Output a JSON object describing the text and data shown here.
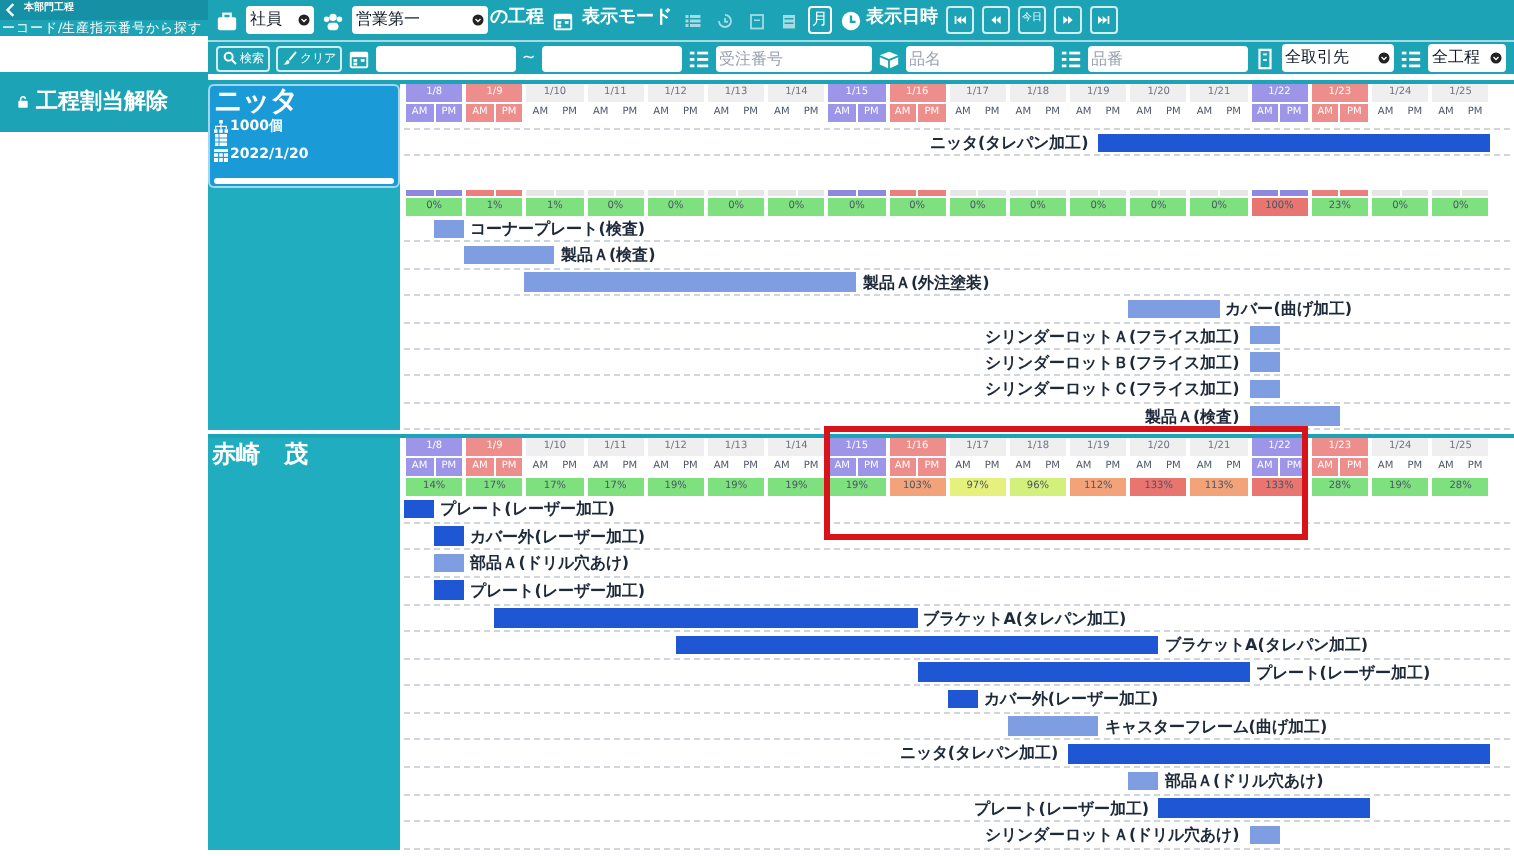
{
  "sidebar": {
    "title": "本部門工程",
    "hint": "ーコード/生産指示番号から探す",
    "action": "工程割当解除"
  },
  "toolbar": {
    "employee_select": "社員",
    "department_select": "営業第一",
    "suffix": "の工程",
    "display_mode_label": "表示モード",
    "view_modes": [
      {
        "kind": "list",
        "selected": false
      },
      {
        "kind": "history",
        "selected": false
      },
      {
        "kind": "day",
        "selected": false
      },
      {
        "kind": "week",
        "selected": false
      },
      {
        "label": "月",
        "selected": true
      }
    ],
    "datetime_label": "表示日時",
    "nav": [
      {
        "kind": "first"
      },
      {
        "kind": "prev"
      },
      {
        "kind": "today",
        "label": "今日"
      },
      {
        "kind": "next"
      },
      {
        "kind": "last"
      }
    ]
  },
  "filters": {
    "search_button": "検索",
    "clear_button": "クリア",
    "range_separator": "~",
    "order_number": {
      "placeholder": "受注番号"
    },
    "item_name": {
      "placeholder": "品名"
    },
    "item_number": {
      "placeholder": "品番"
    },
    "client_select": "全取引先",
    "process_select": "全工程"
  },
  "groups": [
    {
      "kind": "product",
      "name": "ニッタ",
      "quantity": "1000個",
      "due_date": "2022/1/20",
      "days": [
        {
          "date": "1/8",
          "kind": "saturday",
          "am": "AM",
          "pm": "PM"
        },
        {
          "date": "1/9",
          "kind": "sunday",
          "am": "AM",
          "pm": "PM"
        },
        {
          "date": "1/10",
          "kind": "weekday",
          "am": "AM",
          "pm": "PM"
        },
        {
          "date": "1/11",
          "kind": "weekday",
          "am": "AM",
          "pm": "PM"
        },
        {
          "date": "1/12",
          "kind": "weekday",
          "am": "AM",
          "pm": "PM"
        },
        {
          "date": "1/13",
          "kind": "weekday",
          "am": "AM",
          "pm": "PM"
        },
        {
          "date": "1/14",
          "kind": "weekday",
          "am": "AM",
          "pm": "PM"
        },
        {
          "date": "1/15",
          "kind": "saturday",
          "am": "AM",
          "pm": "PM"
        },
        {
          "date": "1/16",
          "kind": "sunday",
          "am": "AM",
          "pm": "PM"
        },
        {
          "date": "1/17",
          "kind": "weekday",
          "am": "AM",
          "pm": "PM"
        },
        {
          "date": "1/18",
          "kind": "weekday",
          "am": "AM",
          "pm": "PM"
        },
        {
          "date": "1/19",
          "kind": "weekday",
          "am": "AM",
          "pm": "PM"
        },
        {
          "date": "1/20",
          "kind": "weekday",
          "am": "AM",
          "pm": "PM"
        },
        {
          "date": "1/21",
          "kind": "weekday",
          "am": "AM",
          "pm": "PM"
        },
        {
          "date": "1/22",
          "kind": "saturday",
          "am": "AM",
          "pm": "PM"
        },
        {
          "date": "1/23",
          "kind": "sunday",
          "am": "AM",
          "pm": "PM"
        },
        {
          "date": "1/24",
          "kind": "weekday",
          "am": "AM",
          "pm": "PM"
        },
        {
          "date": "1/25",
          "kind": "weekday",
          "am": "AM",
          "pm": "PM"
        }
      ],
      "summary_bar": {
        "label": "ニッタ(タレパン加工)",
        "color": "#1f56d4",
        "label_left": true,
        "schedule": [
          false,
          false,
          false,
          false,
          false,
          false,
          false,
          false,
          false,
          false,
          false,
          false,
          false,
          false,
          false,
          false,
          false,
          false,
          false,
          false,
          false,
          false,
          false,
          true,
          true,
          true,
          true,
          true,
          true,
          true,
          true,
          true,
          true,
          true,
          true,
          true
        ]
      },
      "loads": [
        {
          "text": "0%",
          "color": "#7fe07f"
        },
        {
          "text": "1%",
          "color": "#7fe07f"
        },
        {
          "text": "1%",
          "color": "#7fe07f"
        },
        {
          "text": "0%",
          "color": "#7fe07f"
        },
        {
          "text": "0%",
          "color": "#7fe07f"
        },
        {
          "text": "0%",
          "color": "#7fe07f"
        },
        {
          "text": "0%",
          "color": "#7fe07f"
        },
        {
          "text": "0%",
          "color": "#7fe07f"
        },
        {
          "text": "0%",
          "color": "#7fe07f"
        },
        {
          "text": "0%",
          "color": "#7fe07f"
        },
        {
          "text": "0%",
          "color": "#7fe07f"
        },
        {
          "text": "0%",
          "color": "#7fe07f"
        },
        {
          "text": "0%",
          "color": "#7fe07f"
        },
        {
          "text": "0%",
          "color": "#7fe07f"
        },
        {
          "text": "100%",
          "color": "#e8756f"
        },
        {
          "text": "23%",
          "color": "#7fe07f"
        },
        {
          "text": "0%",
          "color": "#7fe07f"
        },
        {
          "text": "0%",
          "color": "#7fe07f"
        }
      ],
      "tasks": [
        {
          "label": "コーナープレート(検査)",
          "color": "#7f9ee2",
          "label_left": false,
          "schedule": [
            false,
            true,
            false,
            false,
            false,
            false,
            false,
            false,
            false,
            false,
            false,
            false,
            false,
            false,
            false,
            false,
            false,
            false,
            false,
            false,
            false,
            false,
            false,
            false,
            false,
            false,
            false,
            false,
            false,
            false,
            false,
            false,
            false,
            false,
            false,
            false
          ]
        },
        {
          "label": "製品Ａ(検査)",
          "color": "#7f9ee2",
          "label_left": false,
          "schedule": [
            false,
            false,
            true,
            true,
            true,
            false,
            false,
            false,
            false,
            false,
            false,
            false,
            false,
            false,
            false,
            false,
            false,
            false,
            false,
            false,
            false,
            false,
            false,
            false,
            false,
            false,
            false,
            false,
            false,
            false,
            false,
            false,
            false,
            false,
            false,
            false
          ]
        },
        {
          "label": "製品Ａ(外注塗装)",
          "color": "#7f9ee2",
          "label_left": false,
          "schedule": [
            false,
            false,
            false,
            false,
            true,
            true,
            true,
            true,
            true,
            true,
            true,
            true,
            true,
            true,
            true,
            false,
            false,
            false,
            false,
            false,
            false,
            false,
            false,
            false,
            false,
            false,
            false,
            false,
            false,
            false,
            false,
            false,
            false,
            false,
            false,
            false
          ]
        },
        {
          "label": "カバー(曲げ加工)",
          "color": "#7f9ee2",
          "label_left": false,
          "schedule": [
            false,
            false,
            false,
            false,
            false,
            false,
            false,
            false,
            false,
            false,
            false,
            false,
            false,
            false,
            false,
            false,
            false,
            false,
            false,
            false,
            false,
            false,
            false,
            false,
            true,
            true,
            true,
            false,
            false,
            false,
            false,
            false,
            false,
            false,
            false,
            false
          ]
        },
        {
          "label": "シリンダーロットＡ(フライス加工)",
          "color": "#7f9ee2",
          "label_left": true,
          "schedule": [
            false,
            false,
            false,
            false,
            false,
            false,
            false,
            false,
            false,
            false,
            false,
            false,
            false,
            false,
            false,
            false,
            false,
            false,
            false,
            false,
            false,
            false,
            false,
            false,
            false,
            false,
            false,
            false,
            true,
            false,
            false,
            false,
            false,
            false,
            false,
            false
          ]
        },
        {
          "label": "シリンダーロットＢ(フライス加工)",
          "color": "#7f9ee2",
          "label_left": true,
          "schedule": [
            false,
            false,
            false,
            false,
            false,
            false,
            false,
            false,
            false,
            false,
            false,
            false,
            false,
            false,
            false,
            false,
            false,
            false,
            false,
            false,
            false,
            false,
            false,
            false,
            false,
            false,
            false,
            false,
            true,
            false,
            false,
            false,
            false,
            false,
            false,
            false
          ]
        },
        {
          "label": "シリンダーロットＣ(フライス加工)",
          "color": "#7f9ee2",
          "label_left": true,
          "schedule": [
            false,
            false,
            false,
            false,
            false,
            false,
            false,
            false,
            false,
            false,
            false,
            false,
            false,
            false,
            false,
            false,
            false,
            false,
            false,
            false,
            false,
            false,
            false,
            false,
            false,
            false,
            false,
            false,
            true,
            false,
            false,
            false,
            false,
            false,
            false,
            false
          ]
        },
        {
          "label": "製品Ａ(検査)",
          "color": "#7f9ee2",
          "label_left": true,
          "schedule": [
            false,
            false,
            false,
            false,
            false,
            false,
            false,
            false,
            false,
            false,
            false,
            false,
            false,
            false,
            false,
            false,
            false,
            false,
            false,
            false,
            false,
            false,
            false,
            false,
            false,
            false,
            false,
            false,
            true,
            true,
            true,
            false,
            false,
            false,
            false,
            false
          ]
        }
      ]
    },
    {
      "kind": "employee",
      "name": "赤崎　茂",
      "days": [
        {
          "date": "1/8",
          "kind": "saturday",
          "am": "AM",
          "pm": "PM"
        },
        {
          "date": "1/9",
          "kind": "sunday",
          "am": "AM",
          "pm": "PM"
        },
        {
          "date": "1/10",
          "kind": "weekday",
          "am": "AM",
          "pm": "PM"
        },
        {
          "date": "1/11",
          "kind": "weekday",
          "am": "AM",
          "pm": "PM"
        },
        {
          "date": "1/12",
          "kind": "weekday",
          "am": "AM",
          "pm": "PM"
        },
        {
          "date": "1/13",
          "kind": "weekday",
          "am": "AM",
          "pm": "PM"
        },
        {
          "date": "1/14",
          "kind": "weekday",
          "am": "AM",
          "pm": "PM"
        },
        {
          "date": "1/15",
          "kind": "saturday",
          "am": "AM",
          "pm": "PM"
        },
        {
          "date": "1/16",
          "kind": "sunday",
          "am": "AM",
          "pm": "PM"
        },
        {
          "date": "1/17",
          "kind": "weekday",
          "am": "AM",
          "pm": "PM"
        },
        {
          "date": "1/18",
          "kind": "weekday",
          "am": "AM",
          "pm": "PM"
        },
        {
          "date": "1/19",
          "kind": "weekday",
          "am": "AM",
          "pm": "PM"
        },
        {
          "date": "1/20",
          "kind": "weekday",
          "am": "AM",
          "pm": "PM"
        },
        {
          "date": "1/21",
          "kind": "weekday",
          "am": "AM",
          "pm": "PM"
        },
        {
          "date": "1/22",
          "kind": "saturday",
          "am": "AM",
          "pm": "PM"
        },
        {
          "date": "1/23",
          "kind": "sunday",
          "am": "AM",
          "pm": "PM"
        },
        {
          "date": "1/24",
          "kind": "weekday",
          "am": "AM",
          "pm": "PM"
        },
        {
          "date": "1/25",
          "kind": "weekday",
          "am": "AM",
          "pm": "PM"
        }
      ],
      "loads": [
        {
          "text": "14%",
          "color": "#7fe07f",
          "highlighted": false
        },
        {
          "text": "17%",
          "color": "#7fe07f",
          "highlighted": false
        },
        {
          "text": "17%",
          "color": "#7fe07f",
          "highlighted": false
        },
        {
          "text": "17%",
          "color": "#7fe07f",
          "highlighted": false
        },
        {
          "text": "19%",
          "color": "#7fe07f",
          "highlighted": false
        },
        {
          "text": "19%",
          "color": "#7fe07f",
          "highlighted": false
        },
        {
          "text": "19%",
          "color": "#7fe07f",
          "highlighted": false
        },
        {
          "text": "19%",
          "color": "#7fe07f",
          "highlighted": true
        },
        {
          "text": "103%",
          "color": "#f2a37a",
          "highlighted": true
        },
        {
          "text": "97%",
          "color": "#e6f07c",
          "highlighted": true
        },
        {
          "text": "96%",
          "color": "#d3ef7c",
          "highlighted": true
        },
        {
          "text": "112%",
          "color": "#f2a37a",
          "highlighted": true
        },
        {
          "text": "133%",
          "color": "#e8756f",
          "highlighted": true
        },
        {
          "text": "113%",
          "color": "#f2a37a",
          "highlighted": true
        },
        {
          "text": "133%",
          "color": "#e8756f",
          "highlighted": true
        },
        {
          "text": "28%",
          "color": "#7fe07f",
          "highlighted": false
        },
        {
          "text": "19%",
          "color": "#7fe07f",
          "highlighted": false
        },
        {
          "text": "28%",
          "color": "#7fe07f",
          "highlighted": false
        }
      ],
      "tasks": [
        {
          "label": "プレート(レーザー加工)",
          "color": "#1f56d4",
          "label_left": false,
          "schedule": [
            true,
            false,
            false,
            false,
            false,
            false,
            false,
            false,
            false,
            false,
            false,
            false,
            false,
            false,
            false,
            false,
            false,
            false,
            false,
            false,
            false,
            false,
            false,
            false,
            false,
            false,
            false,
            false,
            false,
            false,
            false,
            false,
            false,
            false,
            false,
            false
          ]
        },
        {
          "label": "カバー外(レーザー加工)",
          "color": "#1f56d4",
          "label_left": false,
          "schedule": [
            false,
            true,
            false,
            false,
            false,
            false,
            false,
            false,
            false,
            false,
            false,
            false,
            false,
            false,
            false,
            false,
            false,
            false,
            false,
            false,
            false,
            false,
            false,
            false,
            false,
            false,
            false,
            false,
            false,
            false,
            false,
            false,
            false,
            false,
            false,
            false
          ]
        },
        {
          "label": "部品Ａ(ドリル穴あけ)",
          "color": "#7f9ee2",
          "label_left": false,
          "schedule": [
            false,
            true,
            false,
            false,
            false,
            false,
            false,
            false,
            false,
            false,
            false,
            false,
            false,
            false,
            false,
            false,
            false,
            false,
            false,
            false,
            false,
            false,
            false,
            false,
            false,
            false,
            false,
            false,
            false,
            false,
            false,
            false,
            false,
            false,
            false,
            false
          ]
        },
        {
          "label": "プレート(レーザー加工)",
          "color": "#1f56d4",
          "label_left": false,
          "schedule": [
            false,
            true,
            false,
            false,
            false,
            false,
            false,
            false,
            false,
            false,
            false,
            false,
            false,
            false,
            false,
            false,
            false,
            false,
            false,
            false,
            false,
            false,
            false,
            false,
            false,
            false,
            false,
            false,
            false,
            false,
            false,
            false,
            false,
            false,
            false,
            false
          ]
        },
        {
          "label": "ブラケットA(タレパン加工)",
          "color": "#1f56d4",
          "label_left": false,
          "schedule": [
            false,
            false,
            false,
            true,
            true,
            true,
            true,
            true,
            true,
            true,
            true,
            true,
            true,
            true,
            true,
            true,
            true,
            false,
            false,
            false,
            false,
            false,
            false,
            false,
            false,
            false,
            false,
            false,
            false,
            false,
            false,
            false,
            false,
            false,
            false,
            false
          ]
        },
        {
          "label": "ブラケットA(タレパン加工)",
          "color": "#1f56d4",
          "label_left": false,
          "schedule": [
            false,
            false,
            false,
            false,
            false,
            false,
            false,
            false,
            false,
            true,
            true,
            true,
            true,
            true,
            true,
            true,
            true,
            true,
            true,
            true,
            true,
            true,
            true,
            true,
            true,
            false,
            false,
            false,
            false,
            false,
            false,
            false,
            false,
            false,
            false,
            false
          ]
        },
        {
          "label": "プレート(レーザー加工)",
          "color": "#1f56d4",
          "label_left": false,
          "schedule": [
            false,
            false,
            false,
            false,
            false,
            false,
            false,
            false,
            false,
            false,
            false,
            false,
            false,
            false,
            false,
            false,
            false,
            true,
            true,
            true,
            true,
            true,
            true,
            true,
            true,
            true,
            true,
            true,
            false,
            false,
            false,
            false,
            false,
            false,
            false,
            false
          ]
        },
        {
          "label": "カバー外(レーザー加工)",
          "color": "#1f56d4",
          "label_left": false,
          "schedule": [
            false,
            false,
            false,
            false,
            false,
            false,
            false,
            false,
            false,
            false,
            false,
            false,
            false,
            false,
            false,
            false,
            false,
            false,
            true,
            false,
            false,
            false,
            false,
            false,
            false,
            false,
            false,
            false,
            false,
            false,
            false,
            false,
            false,
            false,
            false,
            false
          ]
        },
        {
          "label": "キャスターフレーム(曲げ加工)",
          "color": "#7f9ee2",
          "label_left": false,
          "schedule": [
            false,
            false,
            false,
            false,
            false,
            false,
            false,
            false,
            false,
            false,
            false,
            false,
            false,
            false,
            false,
            false,
            false,
            false,
            false,
            false,
            true,
            true,
            true,
            false,
            false,
            false,
            false,
            false,
            false,
            false,
            false,
            false,
            false,
            false,
            false,
            false
          ]
        },
        {
          "label": "ニッタ(タレパン加工)",
          "color": "#1f56d4",
          "label_left": true,
          "schedule": [
            false,
            false,
            false,
            false,
            false,
            false,
            false,
            false,
            false,
            false,
            false,
            false,
            false,
            false,
            false,
            false,
            false,
            false,
            false,
            false,
            false,
            false,
            true,
            true,
            true,
            true,
            true,
            true,
            true,
            true,
            true,
            true,
            true,
            true,
            true,
            true
          ]
        },
        {
          "label": "部品Ａ(ドリル穴あけ)",
          "color": "#7f9ee2",
          "label_left": false,
          "schedule": [
            false,
            false,
            false,
            false,
            false,
            false,
            false,
            false,
            false,
            false,
            false,
            false,
            false,
            false,
            false,
            false,
            false,
            false,
            false,
            false,
            false,
            false,
            false,
            false,
            true,
            false,
            false,
            false,
            false,
            false,
            false,
            false,
            false,
            false,
            false,
            false
          ]
        },
        {
          "label": "プレート(レーザー加工)",
          "color": "#1f56d4",
          "label_left": true,
          "schedule": [
            false,
            false,
            false,
            false,
            false,
            false,
            false,
            false,
            false,
            false,
            false,
            false,
            false,
            false,
            false,
            false,
            false,
            false,
            false,
            false,
            false,
            false,
            false,
            false,
            false,
            true,
            true,
            true,
            true,
            true,
            true,
            true,
            false,
            false,
            false,
            false
          ]
        },
        {
          "label": "シリンダーロットＡ(ドリル穴あけ)",
          "color": "#7f9ee2",
          "label_left": true,
          "schedule": [
            false,
            false,
            false,
            false,
            false,
            false,
            false,
            false,
            false,
            false,
            false,
            false,
            false,
            false,
            false,
            false,
            false,
            false,
            false,
            false,
            false,
            false,
            false,
            false,
            false,
            false,
            false,
            false,
            true,
            false,
            false,
            false,
            false,
            false,
            false,
            false
          ]
        }
      ]
    }
  ]
}
